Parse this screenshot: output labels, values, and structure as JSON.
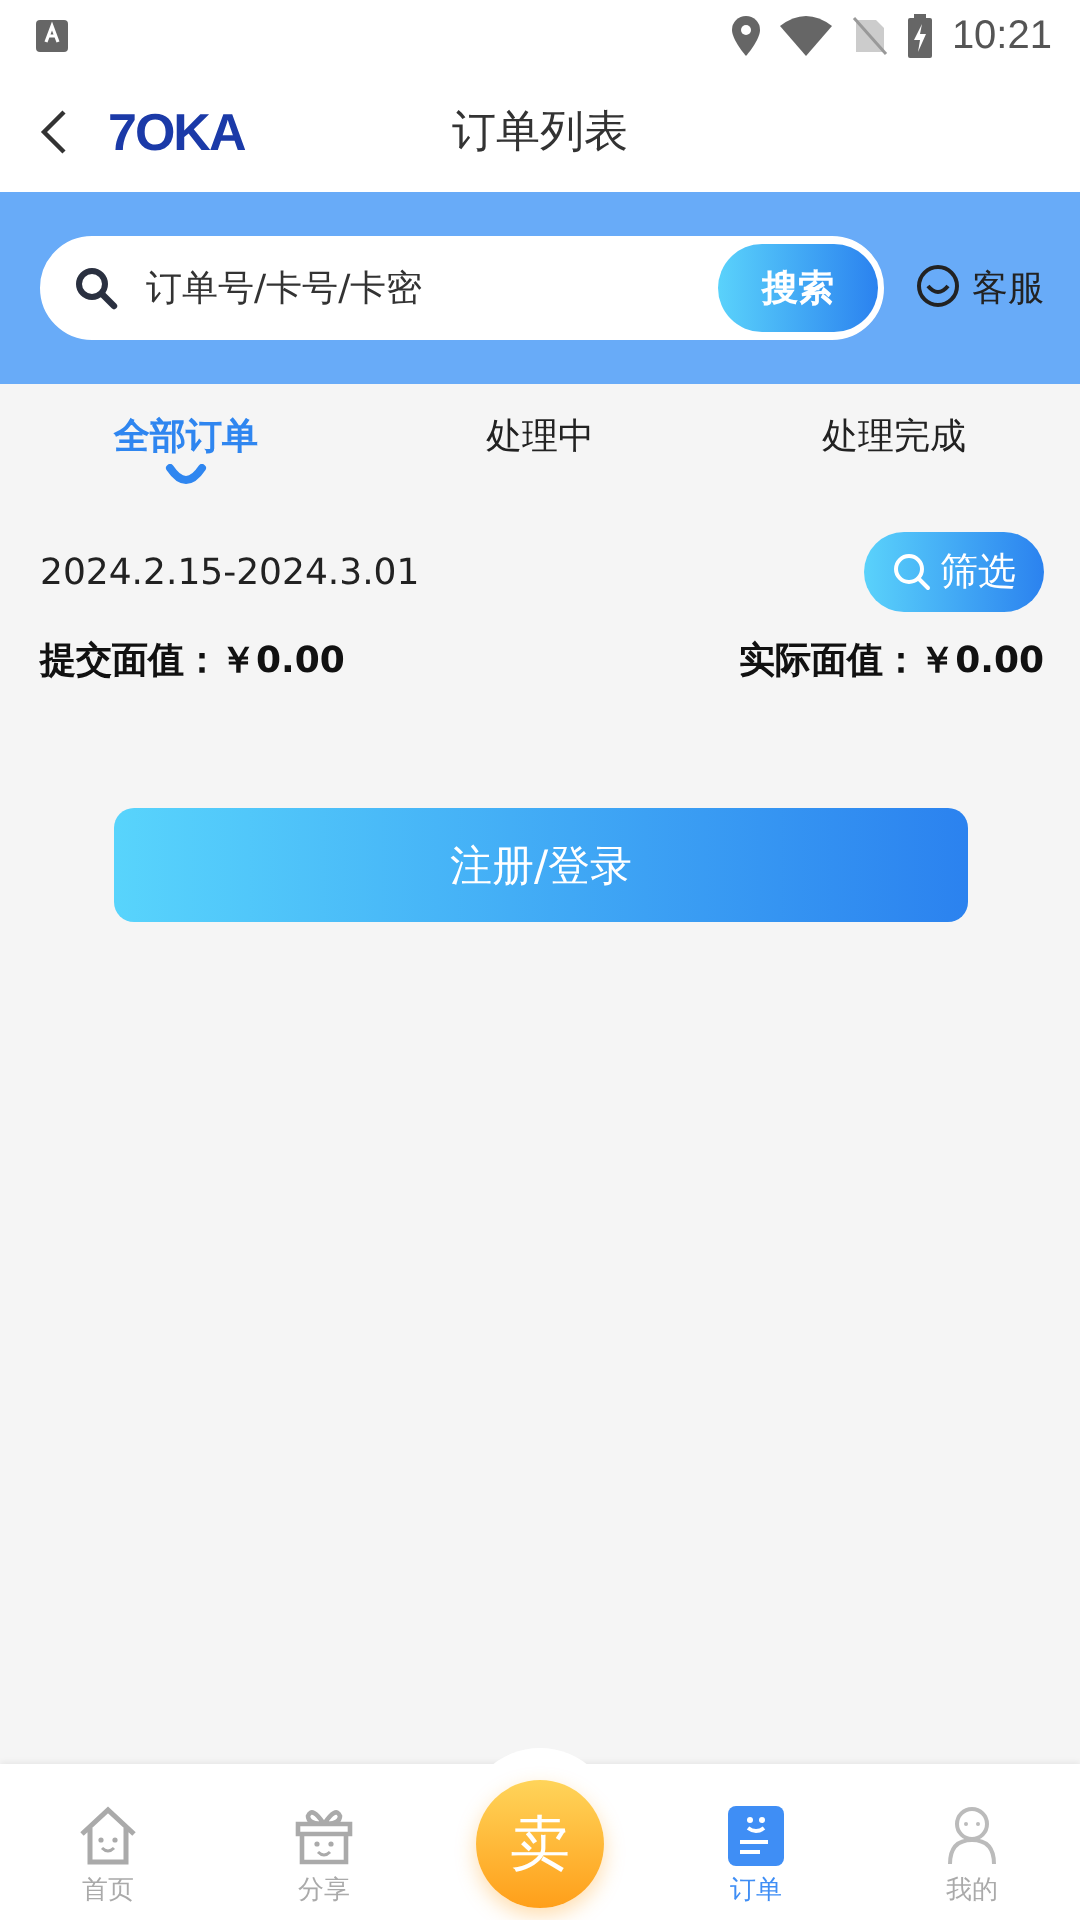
{
  "status_bar": {
    "time": "10:21"
  },
  "header": {
    "logo": "7OKA",
    "title": "订单列表"
  },
  "search": {
    "placeholder": "订单号/卡号/卡密",
    "button": "搜索",
    "service": "客服"
  },
  "tabs": [
    {
      "label": "全部订单",
      "selected": true
    },
    {
      "label": "处理中",
      "selected": false
    },
    {
      "label": "处理完成",
      "selected": false
    }
  ],
  "date_range": "2024.2.15-2024.3.01",
  "filter_button": "筛选",
  "totals": [
    {
      "label": "提交面值：",
      "value": "￥0.00"
    },
    {
      "label": "实际面值：",
      "value": "￥0.00"
    }
  ],
  "login_button": "注册/登录",
  "bottom_nav": [
    {
      "kind": "home",
      "label": "首页",
      "selected": false
    },
    {
      "kind": "gift",
      "label": "分享",
      "selected": false
    },
    {
      "kind": "sell",
      "label": "卖",
      "selected": false
    },
    {
      "kind": "orders",
      "label": "订单",
      "selected": true
    },
    {
      "kind": "user",
      "label": "我的",
      "selected": false
    }
  ]
}
